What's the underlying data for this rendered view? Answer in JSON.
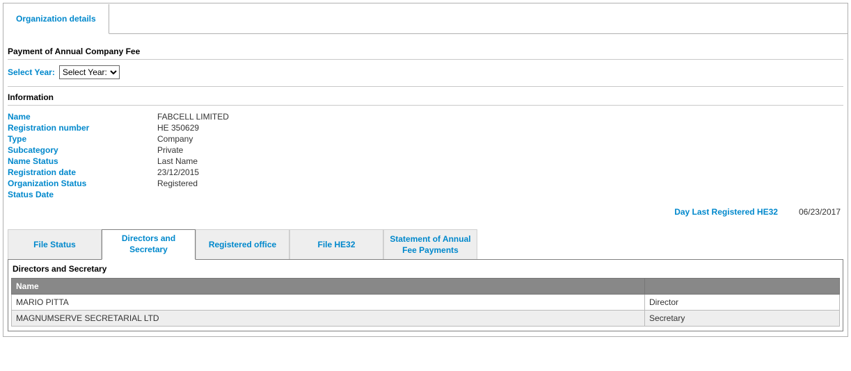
{
  "topTab": {
    "label": "Organization details"
  },
  "payment": {
    "heading": "Payment of Annual Company Fee",
    "selectYearLabel": "Select Year:",
    "selectYearOption": "Select Year:"
  },
  "infoHeading": "Information",
  "info": {
    "nameLabel": "Name",
    "nameValue": "FABCELL LIMITED",
    "regNumLabel": "Registration number",
    "regNumValue": "ΗΕ 350629",
    "typeLabel": "Type",
    "typeValue": "Company",
    "subcatLabel": "Subcategory",
    "subcatValue": "Private",
    "nameStatusLabel": "Name Status",
    "nameStatusValue": "Last Name",
    "regDateLabel": "Registration date",
    "regDateValue": "23/12/2015",
    "orgStatusLabel": "Organization Status",
    "orgStatusValue": "Registered",
    "statusDateLabel": "Status Date",
    "statusDateValue": ""
  },
  "he32": {
    "label": "Day Last Registered HE32",
    "date": "06/23/2017"
  },
  "subTabs": {
    "fileStatus": "File Status",
    "directors": "Directors and Secretary",
    "registeredOffice": "Registered office",
    "fileHE32": "File HE32",
    "statementFee": "Statement of Annual Fee Payments"
  },
  "directorsPanel": {
    "title": "Directors and Secretary",
    "colName": "Name",
    "colRole": "",
    "rows": [
      {
        "name": "MARIO PITTA",
        "role": "Director"
      },
      {
        "name": "MAGNUMSERVE SECRETARIAL LTD",
        "role": "Secretary"
      }
    ]
  }
}
